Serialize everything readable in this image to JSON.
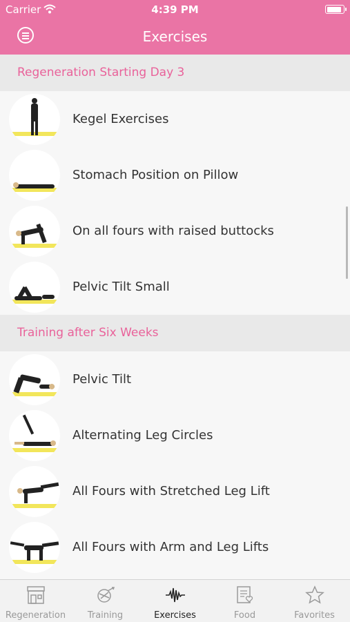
{
  "status": {
    "carrier": "Carrier",
    "time": "4:39 PM",
    "battery_level": 1.0
  },
  "header": {
    "title": "Exercises"
  },
  "sections": [
    {
      "title": "Regeneration Starting Day 3",
      "items": [
        "Kegel Exercises",
        "Stomach Position on Pillow",
        "On all fours with raised buttocks",
        "Pelvic Tilt Small"
      ]
    },
    {
      "title": "Training after Six Weeks",
      "items": [
        "Pelvic Tilt",
        "Alternating Leg Circles",
        "All Fours with Stretched Leg Lift",
        "All Fours with Arm and Leg Lifts"
      ]
    }
  ],
  "tabs": [
    {
      "label": "Regeneration",
      "icon": "storefront-icon"
    },
    {
      "label": "Training",
      "icon": "training-icon"
    },
    {
      "label": "Exercises",
      "icon": "waveform-icon",
      "active": true
    },
    {
      "label": "Food",
      "icon": "food-note-icon"
    },
    {
      "label": "Favorites",
      "icon": "star-icon"
    }
  ],
  "colors": {
    "accent": "#ea74a5",
    "section_text": "#e9629a",
    "mat": "#f2e65b"
  }
}
